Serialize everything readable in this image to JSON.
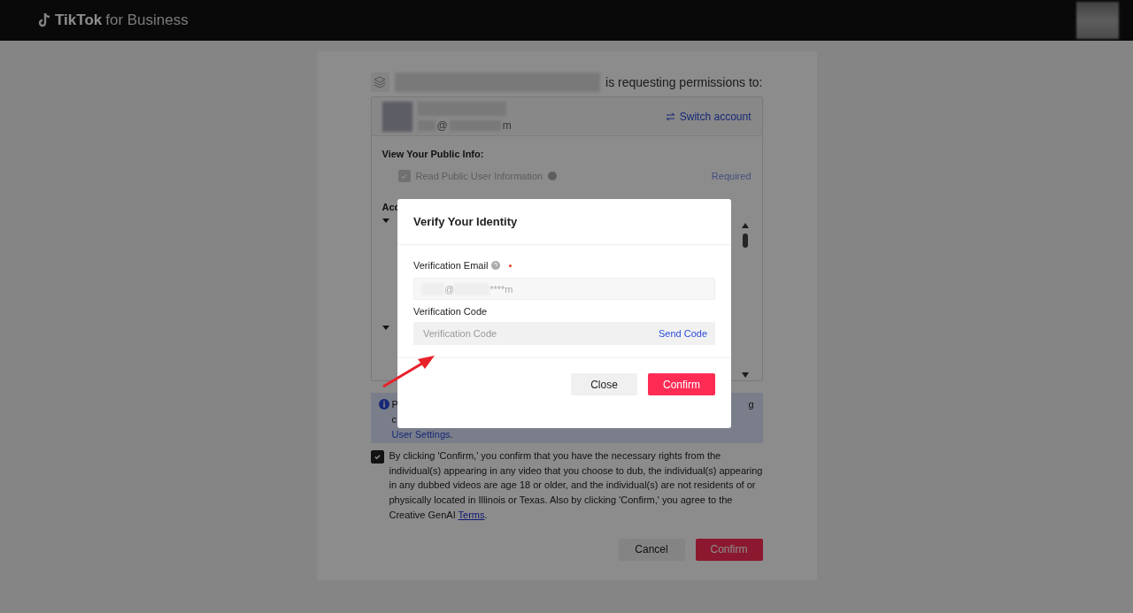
{
  "header": {
    "logo": "TikTok",
    "logo_suffix": "for Business"
  },
  "request": {
    "text": "is requesting permissions to:"
  },
  "account": {
    "email_fragments": [
      "@",
      "m"
    ],
    "switch_link": "Switch account"
  },
  "public_info": {
    "heading": "View Your Public Info:",
    "permission": {
      "label": "Read Public User Information",
      "checked": true,
      "disabled": true,
      "badge": "Required"
    }
  },
  "access_heading": "Acc",
  "notice": {
    "line_1_start": "P",
    "line_1_end": "g",
    "line_2": "c",
    "link": "User Settings",
    "trailing": "."
  },
  "consent": {
    "checked": true,
    "text": "By clicking 'Confirm,' you confirm that you have the necessary rights from the individual(s) appearing in any video that you choose to dub, the individual(s) appearing in any dubbed videos are age 18 or older, and the individual(s) are not residents of or physically located in Illinois or Texas. Also by clicking 'Confirm,' you agree to the Creative GenAI",
    "link": "Terms",
    "trailing": "."
  },
  "buttons": [
    {
      "label": "Cancel",
      "kind": "secondary"
    },
    {
      "label": "Confirm",
      "kind": "primary"
    }
  ],
  "dialog": {
    "title": "Verify Your Identity",
    "email_label": "Verification Email",
    "email_required": true,
    "email_value_fragments": [
      "@",
      "****m"
    ],
    "code_label": "Verification Code",
    "code_placeholder": "Verification Code",
    "send_code": "Send Code",
    "buttons": [
      {
        "label": "Close",
        "kind": "secondary"
      },
      {
        "label": "Confirm",
        "kind": "primary"
      }
    ]
  }
}
